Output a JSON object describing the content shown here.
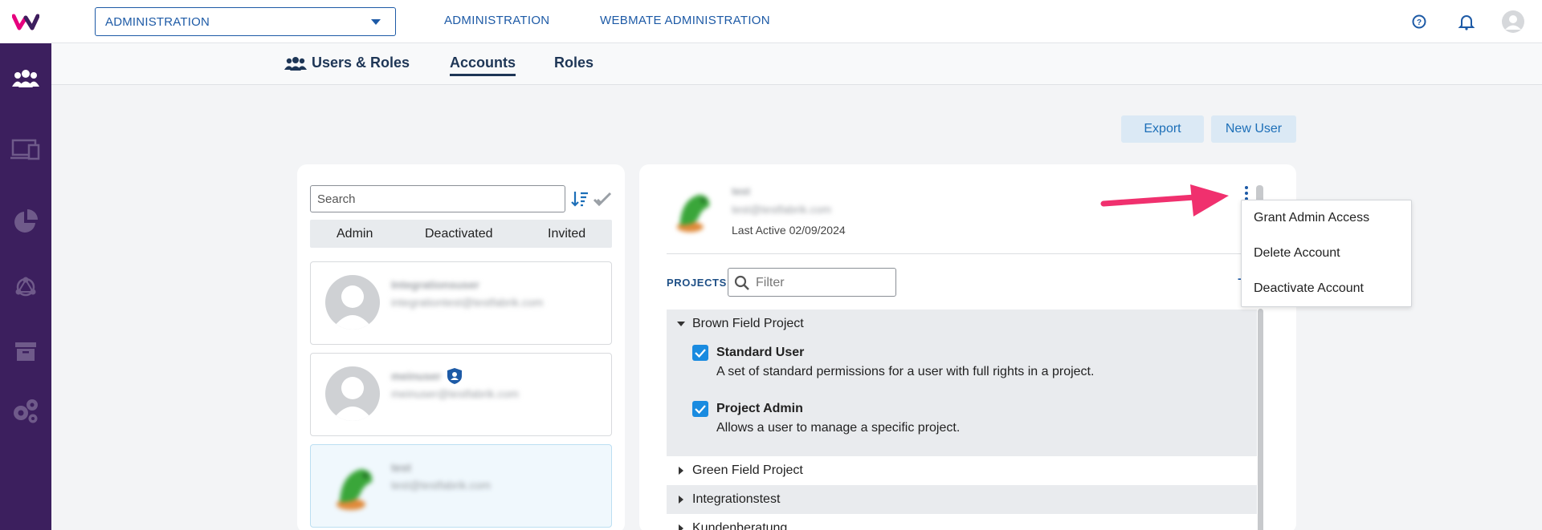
{
  "topbar": {
    "context_select": "ADMINISTRATION",
    "links": [
      "ADMINISTRATION",
      "WEBMATE ADMINISTRATION"
    ]
  },
  "subnav": {
    "section_title": "Users & Roles",
    "tabs": [
      "Accounts",
      "Roles"
    ],
    "active_tab": "Accounts"
  },
  "actions": {
    "export": "Export",
    "new_user": "New User"
  },
  "user_list": {
    "search_placeholder": "Search",
    "filters": [
      "Admin",
      "Deactivated",
      "Invited"
    ],
    "users": [
      {
        "name": "Integrationsuser",
        "email": "integrationtest@testfabrik.com"
      },
      {
        "name": "meinuser",
        "email": "meinuser@testfabrik.com"
      },
      {
        "name": "test",
        "email": "test@testfabrik.com"
      }
    ]
  },
  "detail": {
    "name": "test",
    "email": "test@testfabrik.com",
    "last_active": "Last Active 02/09/2024",
    "projects_label": "PROJECTS",
    "filter_placeholder": "Filter",
    "projects": [
      {
        "name": "Brown Field Project",
        "expanded": true,
        "roles": [
          {
            "title": "Standard User",
            "description": "A set of standard permissions for a user with full rights in a project.",
            "checked": true
          },
          {
            "title": "Project Admin",
            "description": "Allows a user to manage a specific project.",
            "checked": true
          }
        ]
      },
      {
        "name": "Green Field Project",
        "expanded": false
      },
      {
        "name": "Integrationstest",
        "expanded": false
      },
      {
        "name": "Kundenberatung",
        "expanded": false
      }
    ]
  },
  "account_menu": {
    "items": [
      "Grant Admin Access",
      "Delete Account",
      "Deactivate Account"
    ]
  },
  "colors": {
    "rail": "#3c1f5e",
    "link_blue": "#1d5aa6",
    "checkbox_blue": "#1a8be0",
    "arrow_pink": "#f0306e"
  }
}
